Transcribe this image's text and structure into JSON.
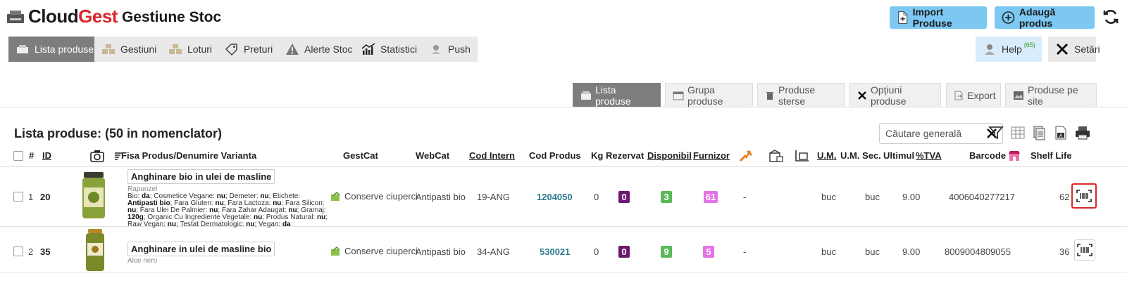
{
  "app": {
    "brand_part1": "Cloud",
    "brand_part2": "Gest",
    "subtitle": "Gestiune Stoc",
    "import_label": "Import Produse",
    "add_label": "Adaugă produs"
  },
  "nav": {
    "items": [
      {
        "label": "Lista produse",
        "icon": "printer-box-icon",
        "active": true
      },
      {
        "label": "Gestiuni",
        "icon": "boxes-icon"
      },
      {
        "label": "Loturi",
        "icon": "boxes-icon"
      },
      {
        "label": "Preturi",
        "icon": "price-tag-icon"
      },
      {
        "label": "Alerte Stoc",
        "icon": "warning-icon"
      },
      {
        "label": "Statistici",
        "icon": "chart-icon"
      },
      {
        "label": "Push",
        "icon": "push-icon"
      }
    ],
    "help_label": "Help",
    "help_count": "(65)",
    "settings_label": "Setări"
  },
  "subtabs": [
    {
      "label": "Lista produse",
      "active": true
    },
    {
      "label": "Grupa produse"
    },
    {
      "label": "Produse sterse"
    },
    {
      "label": "Opțiuni produse"
    },
    {
      "label": "Export"
    },
    {
      "label": "Produse pe site"
    }
  ],
  "list": {
    "title": "Lista produse: (50 in nomenclator)",
    "search_placeholder": "Căutare generală"
  },
  "table": {
    "headers": {
      "num": "#",
      "id": "ID",
      "fisa": "Fisa Produs/Denumire Varianta",
      "gestcat": "GestCat",
      "webcat": "WebCat",
      "cod_intern": "Cod Intern",
      "cod_produs": "Cod Produs",
      "kg": "Kg",
      "rezervat": "Rezervat",
      "disponibil": "Disponibil",
      "furnizor": "Furnizor",
      "um": "U.M.",
      "um_sec": "U.M. Sec.",
      "ultimul": "Ultimul",
      "tva": "%TVA",
      "barcode": "Barcode",
      "shelf": "Shelf Life"
    },
    "rows": [
      {
        "num": "1",
        "id": "20",
        "name": "Anghinare bio in ulei de masline",
        "brand": "Rapunzel",
        "attrs": [
          [
            "Bio: ",
            "da"
          ],
          [
            "; Cosmetice Vegane: ",
            "nu"
          ],
          [
            "; Demeter: ",
            "nu"
          ],
          [
            "; Etichete: ",
            ""
          ],
          [
            "Antipasti bio",
            ""
          ],
          [
            "; Fara Gluten: ",
            "nu"
          ],
          [
            "; Fara Lactoza: ",
            "nu"
          ],
          [
            "; Fara Silicon: ",
            "nu"
          ],
          [
            "; Fara Ulei De Palmier: ",
            "nu"
          ],
          [
            "; Fara Zahar Adaugat: ",
            "nu"
          ],
          [
            "; Gramaj: ",
            ""
          ],
          [
            "120g",
            ""
          ],
          [
            "; Organic Cu Ingrediente Vegetale: ",
            "nu"
          ],
          [
            "; Produs Natural: ",
            "nu"
          ],
          [
            "; Raw Vegan: ",
            "nu"
          ],
          [
            "; Testat Dermatologic: ",
            "nu"
          ],
          [
            "; Vegan: ",
            "da"
          ]
        ],
        "gestcat": "Conserve ciuperci",
        "webcat": "Antipasti bio",
        "cod_intern": "19-ANG",
        "cod_produs": "1204050",
        "kg": "0",
        "rezervat": "0",
        "disponibil": "3",
        "furnizor": "61",
        "dash": "-",
        "um": "buc",
        "um_sec": "buc",
        "tva": "9.00",
        "barcode": "4006040277217",
        "shelf": "62"
      },
      {
        "num": "2",
        "id": "35",
        "name": "Anghinare in ulei de masline bio",
        "brand": "Alce nero",
        "gestcat": "Conserve ciuperci",
        "webcat": "Antipasti bio",
        "cod_intern": "34-ANG",
        "cod_produs": "530021",
        "kg": "0",
        "rezervat": "0",
        "disponibil": "9",
        "furnizor": "5",
        "dash": "-",
        "um": "buc",
        "um_sec": "buc",
        "tva": "9.00",
        "barcode": "8009004809055",
        "shelf": "36"
      }
    ]
  },
  "colors": {
    "brand_red": "#d9262c",
    "header_button": "#7cc8f2",
    "active_tab": "#7d7d7d",
    "rezervat": "#6b1a6b",
    "disponibil": "#5cb85c",
    "furnizor": "#e573e5",
    "code_link": "#2a7a8c"
  }
}
